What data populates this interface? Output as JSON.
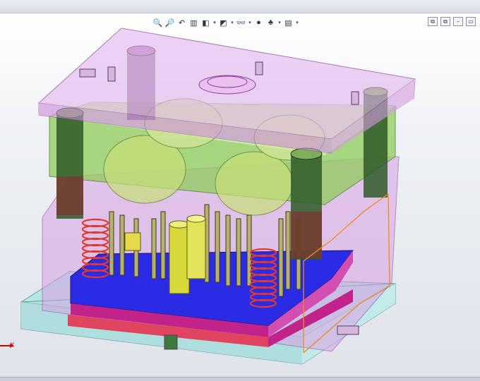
{
  "toolbar": {
    "tools": [
      {
        "name": "zoom-to-fit-icon",
        "glyph": "🔍"
      },
      {
        "name": "zoom-to-area-icon",
        "glyph": "🔎"
      },
      {
        "name": "previous-view-icon",
        "glyph": "↶"
      },
      {
        "name": "section-view-icon",
        "glyph": "▥"
      },
      {
        "name": "view-orientation-icon",
        "glyph": "◧",
        "dropdown": true
      },
      {
        "name": "display-style-icon",
        "glyph": "◩",
        "dropdown": true
      },
      {
        "name": "hide-show-items-icon",
        "glyph": "👓",
        "dropdown": true
      },
      {
        "name": "edit-appearance-icon",
        "glyph": "●"
      },
      {
        "name": "apply-scene-icon",
        "glyph": "♣",
        "dropdown": true
      },
      {
        "name": "view-settings-icon",
        "glyph": "▤",
        "dropdown": true
      }
    ]
  },
  "window_controls": {
    "labels": [
      "⧉",
      "⧉",
      "–",
      "▭"
    ]
  },
  "triad": {
    "x_label": "X"
  },
  "colors": {
    "plate_top": "#c46ad6",
    "plate_side": "#d59ae0",
    "green_plate": "#7fc04e",
    "cyan_base": "#9fe0e0",
    "blue_plate": "#2b2be0",
    "magenta_plate": "#c2228a",
    "spring_red": "#e0403a",
    "dome_green": "#b8d06a"
  }
}
